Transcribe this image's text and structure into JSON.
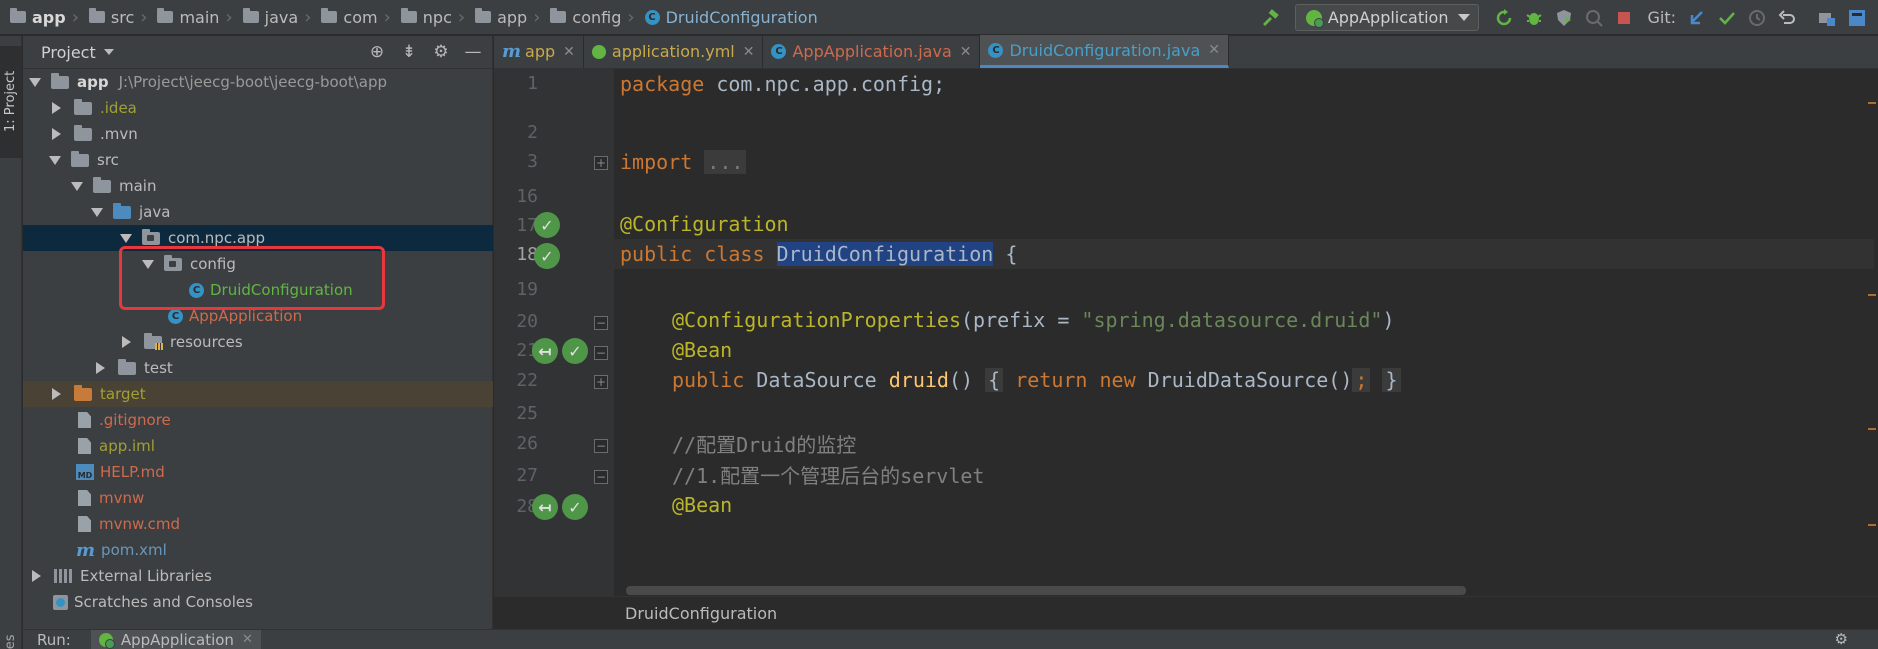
{
  "breadcrumbs": [
    {
      "label": "app",
      "bold": true
    },
    {
      "label": "src"
    },
    {
      "label": "main"
    },
    {
      "label": "java"
    },
    {
      "label": "com"
    },
    {
      "label": "npc"
    },
    {
      "label": "app"
    },
    {
      "label": "config"
    }
  ],
  "breadcrumb_class": "DruidConfiguration",
  "toolbar": {
    "run_config": "AppApplication",
    "git_label": "Git:"
  },
  "project_panel": {
    "title": "Project",
    "root": {
      "label": "app",
      "path": "J:\\Project\\jeecg-boot\\jeecg-boot\\app"
    },
    "items": [
      {
        "label": ".idea"
      },
      {
        "label": ".mvn"
      },
      {
        "label": "src"
      },
      {
        "label": "main"
      },
      {
        "label": "java"
      },
      {
        "label": "com.npc.app"
      },
      {
        "label": "config"
      },
      {
        "label": "DruidConfiguration"
      },
      {
        "label": "AppApplication"
      },
      {
        "label": "resources"
      },
      {
        "label": "test"
      },
      {
        "label": "target"
      },
      {
        "label": ".gitignore"
      },
      {
        "label": "app.iml"
      },
      {
        "label": "HELP.md"
      },
      {
        "label": "mvnw"
      },
      {
        "label": "mvnw.cmd"
      },
      {
        "label": "pom.xml"
      },
      {
        "label": "External Libraries"
      },
      {
        "label": "Scratches and Consoles"
      }
    ]
  },
  "editor": {
    "tabs": [
      {
        "label": "app",
        "color": "#c9a94a"
      },
      {
        "label": "application.yml",
        "color": "#c9a94a"
      },
      {
        "label": "AppApplication.java",
        "color": "#cf6a4c"
      },
      {
        "label": "DruidConfiguration.java",
        "color": "#4a9fc7"
      }
    ],
    "line_numbers": [
      "1",
      "2",
      "3",
      "16",
      "17",
      "18",
      "19",
      "20",
      "21",
      "22",
      "25",
      "26",
      "27",
      "28"
    ],
    "code": {
      "l1_kw": "package",
      "l1_rest": " com.npc.app.config;",
      "l3_kw": "import",
      "l3_fold": "...",
      "l17_ann": "@Configuration",
      "l18_kw": "public class",
      "l18_sel": "DruidConfiguration",
      "l18_rest": " {",
      "l20_ann": "@ConfigurationProperties",
      "l20_open": "(prefix = ",
      "l20_str": "\"spring.datasource.druid\"",
      "l20_close": ")",
      "l21_ann": "@Bean",
      "l22_kw": "public",
      "l22_type": " DataSource ",
      "l22_fn": "druid",
      "l22_paren": "()",
      "l22_open": "{",
      "l22_ret": "return new",
      "l22_body": " DruidDataSource()",
      "l22_semi": ";",
      "l22_close": "}",
      "l26_cmt": "//配置Druid的监控",
      "l27_cmt": "//1.配置一个管理后台的servlet",
      "l28_ann": "@Bean"
    },
    "status_crumb": "DruidConfiguration"
  },
  "left_stripe": {
    "project_label": "1: Project",
    "favorites_label": "vorites"
  },
  "run_bar": {
    "label": "Run:",
    "tab": "AppApplication"
  }
}
